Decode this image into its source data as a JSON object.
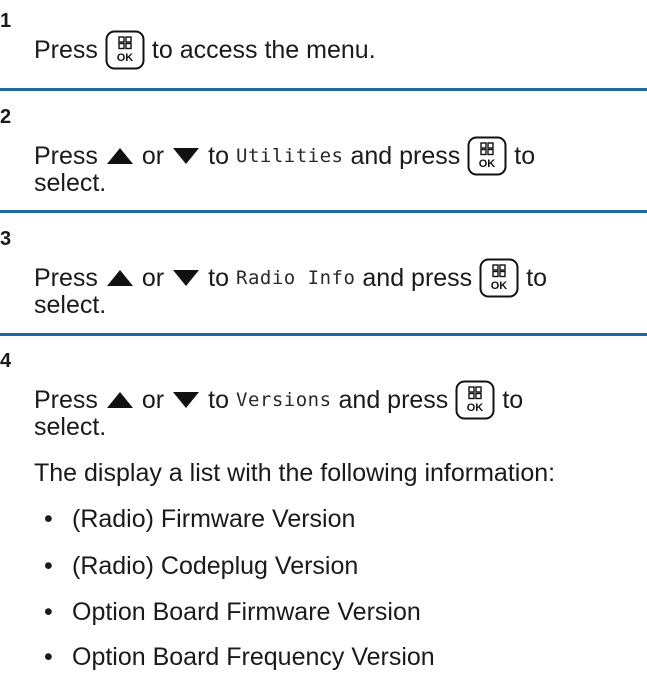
{
  "steps": [
    {
      "number": "1",
      "line1": {
        "prefix": "Press",
        "suffix": "to access the menu."
      }
    },
    {
      "number": "2",
      "line1": {
        "press": "Press",
        "or": "or",
        "to": "to",
        "item": "Utilities",
        "and_press": "and press",
        "end_to": "to"
      },
      "line2": "select."
    },
    {
      "number": "3",
      "line1": {
        "press": "Press",
        "or": "or",
        "to": "to",
        "item": "Radio Info",
        "and_press": "and press",
        "end_to": "to"
      },
      "line2": "select."
    },
    {
      "number": "4",
      "line1": {
        "press": "Press",
        "or": "or",
        "to": "to",
        "item": "Versions",
        "and_press": "and press",
        "end_to": "to"
      },
      "line2": "select.",
      "result": "The display a list with the following information:",
      "bullets": [
        "(Radio) Firmware Version",
        "(Radio) Codeplug Version",
        "Option Board Firmware Version",
        "Option Board Frequency Version"
      ]
    }
  ],
  "icons": {
    "ok_key": "menu-ok-key-icon",
    "up": "up-arrow-icon",
    "down": "down-arrow-icon",
    "ok_label": "OK"
  },
  "colors": {
    "divider": "#1f6aa5",
    "text": "#1a1a1a"
  }
}
